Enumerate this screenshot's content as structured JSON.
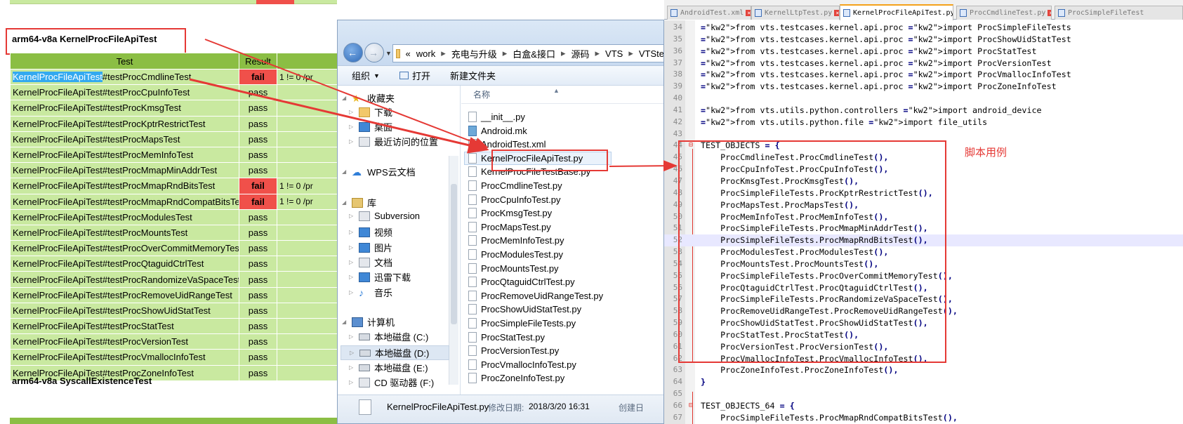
{
  "report": {
    "section_title": "arm64-v8a KernelProcFileApiTest",
    "columns": [
      "Test",
      "Result"
    ],
    "selected_prefix": "KernelProcFileApiTest",
    "rows": [
      {
        "suffix": "#testProcCmdlineTest",
        "result": "fail",
        "detail": "1 != 0 /pr"
      },
      {
        "suffix": "#testProcCpuInfoTest",
        "result": "pass",
        "detail": ""
      },
      {
        "suffix": "#testProcKmsgTest",
        "result": "pass",
        "detail": ""
      },
      {
        "suffix": "#testProcKptrRestrictTest",
        "result": "pass",
        "detail": ""
      },
      {
        "suffix": "#testProcMapsTest",
        "result": "pass",
        "detail": ""
      },
      {
        "suffix": "#testProcMemInfoTest",
        "result": "pass",
        "detail": ""
      },
      {
        "suffix": "#testProcMmapMinAddrTest",
        "result": "pass",
        "detail": ""
      },
      {
        "suffix": "#testProcMmapRndBitsTest",
        "result": "fail",
        "detail": "1 != 0 /pr"
      },
      {
        "suffix": "#testProcMmapRndCompatBitsTest",
        "result": "fail",
        "detail": "1 != 0 /pr"
      },
      {
        "suffix": "#testProcModulesTest",
        "result": "pass",
        "detail": ""
      },
      {
        "suffix": "#testProcMountsTest",
        "result": "pass",
        "detail": ""
      },
      {
        "suffix": "#testProcOverCommitMemoryTest",
        "result": "pass",
        "detail": ""
      },
      {
        "suffix": "#testProcQtaguidCtrlTest",
        "result": "pass",
        "detail": ""
      },
      {
        "suffix": "#testProcRandomizeVaSpaceTest",
        "result": "pass",
        "detail": ""
      },
      {
        "suffix": "#testProcRemoveUidRangeTest",
        "result": "pass",
        "detail": ""
      },
      {
        "suffix": "#testProcShowUidStatTest",
        "result": "pass",
        "detail": ""
      },
      {
        "suffix": "#testProcStatTest",
        "result": "pass",
        "detail": ""
      },
      {
        "suffix": "#testProcVersionTest",
        "result": "pass",
        "detail": ""
      },
      {
        "suffix": "#testProcVmallocInfoTest",
        "result": "pass",
        "detail": ""
      },
      {
        "suffix": "#testProcZoneInfoTest",
        "result": "pass",
        "detail": ""
      }
    ],
    "row_name_prefix": "KernelProcFileApiTest",
    "next_section_title": "arm64-v8a  SyscallExistenceTest"
  },
  "explorer": {
    "address": [
      "work",
      "充电与升级",
      "白盒&接口",
      "源码",
      "VTS",
      "VTSte"
    ],
    "address_lead": "«",
    "toolbar": {
      "organize": "组织",
      "open": "打开",
      "new_folder": "新建文件夹"
    },
    "nav": [
      {
        "label": "收藏夹",
        "icon": "star-icon"
      },
      {
        "label": "下载",
        "icon": "download-folder-icon"
      },
      {
        "label": "桌面",
        "icon": "desktop-icon"
      },
      {
        "label": "最近访问的位置",
        "icon": "recent-places-icon"
      },
      {
        "label": "WPS云文档",
        "icon": "cloud-icon"
      },
      {
        "label": "库",
        "icon": "library-icon"
      },
      {
        "label": "Subversion",
        "icon": "subversion-icon"
      },
      {
        "label": "视频",
        "icon": "video-icon"
      },
      {
        "label": "图片",
        "icon": "pictures-icon"
      },
      {
        "label": "文档",
        "icon": "documents-icon"
      },
      {
        "label": "迅雷下载",
        "icon": "thunder-download-icon"
      },
      {
        "label": "音乐",
        "icon": "music-icon"
      },
      {
        "label": "计算机",
        "icon": "computer-icon"
      },
      {
        "label": "本地磁盘 (C:)",
        "icon": "drive-c-icon"
      },
      {
        "label": "本地磁盘 (D:)",
        "icon": "drive-d-icon"
      },
      {
        "label": "本地磁盘 (E:)",
        "icon": "drive-e-icon"
      },
      {
        "label": "CD 驱动器 (F:)",
        "icon": "cd-drive-icon"
      }
    ],
    "column_name": "名称",
    "files": [
      "__init__.py",
      "Android.mk",
      "AndroidTest.xml",
      "KernelProcFileApiTest.py",
      "KernelProcFileTestBase.py",
      "ProcCmdlineTest.py",
      "ProcCpuInfoTest.py",
      "ProcKmsgTest.py",
      "ProcMapsTest.py",
      "ProcMemInfoTest.py",
      "ProcModulesTest.py",
      "ProcMountsTest.py",
      "ProcQtaguidCtrlTest.py",
      "ProcRemoveUidRangeTest.py",
      "ProcShowUidStatTest.py",
      "ProcSimpleFileTests.py",
      "ProcStatTest.py",
      "ProcVersionTest.py",
      "ProcVmallocInfoTest.py",
      "ProcZoneInfoTest.py"
    ],
    "selected_file": "KernelProcFileApiTest.py",
    "status": {
      "name": "KernelProcFileApiTest.py",
      "modified_label": "修改日期:",
      "modified": "2018/3/20 16:31",
      "created_label": "创建日"
    }
  },
  "editor": {
    "tabs": [
      "AndroidTest.xml",
      "KernelLtpTest.py",
      "KernelProcFileApiTest.py",
      "ProcCmdlineTest.py",
      "ProcSimpleFileTest"
    ],
    "active_tab": "KernelProcFileApiTest.py",
    "lines": [
      {
        "n": "34",
        "code": "from vts.testcases.kernel.api.proc import ProcSimpleFileTests"
      },
      {
        "n": "35",
        "code": "from vts.testcases.kernel.api.proc import ProcShowUidStatTest"
      },
      {
        "n": "36",
        "code": "from vts.testcases.kernel.api.proc import ProcStatTest"
      },
      {
        "n": "37",
        "code": "from vts.testcases.kernel.api.proc import ProcVersionTest"
      },
      {
        "n": "38",
        "code": "from vts.testcases.kernel.api.proc import ProcVmallocInfoTest"
      },
      {
        "n": "39",
        "code": "from vts.testcases.kernel.api.proc import ProcZoneInfoTest"
      },
      {
        "n": "40",
        "code": ""
      },
      {
        "n": "41",
        "code": "from vts.utils.python.controllers import android_device"
      },
      {
        "n": "42",
        "code": "from vts.utils.python.file import file_utils"
      },
      {
        "n": "43",
        "code": ""
      },
      {
        "n": "44",
        "code": "TEST_OBJECTS = {"
      },
      {
        "n": "45",
        "code": "    ProcCmdlineTest.ProcCmdlineTest(),"
      },
      {
        "n": "46",
        "code": "    ProcCpuInfoTest.ProcCpuInfoTest(),"
      },
      {
        "n": "47",
        "code": "    ProcKmsgTest.ProcKmsgTest(),"
      },
      {
        "n": "48",
        "code": "    ProcSimpleFileTests.ProcKptrRestrictTest(),"
      },
      {
        "n": "49",
        "code": "    ProcMapsTest.ProcMapsTest(),"
      },
      {
        "n": "50",
        "code": "    ProcMemInfoTest.ProcMemInfoTest(),"
      },
      {
        "n": "51",
        "code": "    ProcSimpleFileTests.ProcMmapMinAddrTest(),"
      },
      {
        "n": "52",
        "code": "    ProcSimpleFileTests.ProcMmapRndBitsTest(),"
      },
      {
        "n": "53",
        "code": "    ProcModulesTest.ProcModulesTest(),"
      },
      {
        "n": "54",
        "code": "    ProcMountsTest.ProcMountsTest(),"
      },
      {
        "n": "55",
        "code": "    ProcSimpleFileTests.ProcOverCommitMemoryTest(),"
      },
      {
        "n": "56",
        "code": "    ProcQtaguidCtrlTest.ProcQtaguidCtrlTest(),"
      },
      {
        "n": "57",
        "code": "    ProcSimpleFileTests.ProcRandomizeVaSpaceTest(),"
      },
      {
        "n": "58",
        "code": "    ProcRemoveUidRangeTest.ProcRemoveUidRangeTest(),"
      },
      {
        "n": "59",
        "code": "    ProcShowUidStatTest.ProcShowUidStatTest(),"
      },
      {
        "n": "60",
        "code": "    ProcStatTest.ProcStatTest(),"
      },
      {
        "n": "61",
        "code": "    ProcVersionTest.ProcVersionTest(),"
      },
      {
        "n": "62",
        "code": "    ProcVmallocInfoTest.ProcVmallocInfoTest(),"
      },
      {
        "n": "63",
        "code": "    ProcZoneInfoTest.ProcZoneInfoTest(),"
      },
      {
        "n": "64",
        "code": "}"
      },
      {
        "n": "65",
        "code": ""
      },
      {
        "n": "66",
        "code": "TEST_OBJECTS_64 = {"
      },
      {
        "n": "67",
        "code": "    ProcSimpleFileTests.ProcMmapRndCompatBitsTest(),"
      }
    ],
    "current_line": "52",
    "annotation": "脚本用例"
  },
  "colors": {
    "pass": "#c9e9a0",
    "fail": "#f0504a",
    "header": "#8bbe44",
    "annotation": "#e53935"
  }
}
